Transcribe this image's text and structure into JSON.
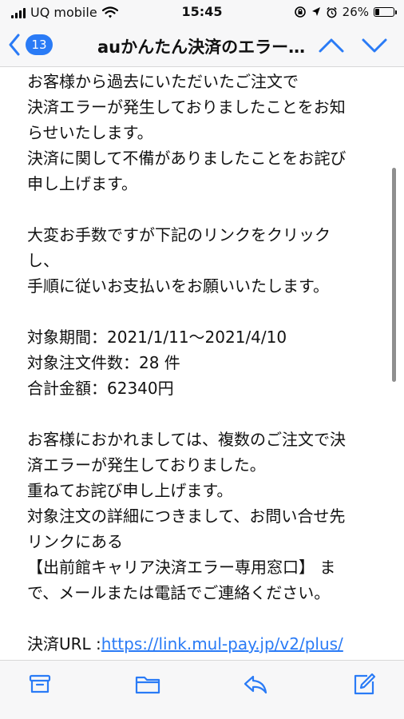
{
  "status_bar": {
    "carrier": "UQ mobile",
    "time": "15:45",
    "battery_percent": "26%",
    "battery_level": 0.26
  },
  "nav": {
    "back_count": "13",
    "title": "auかんたん決済のエラー…"
  },
  "email": {
    "lines": [
      "お客様から過去にいただいたご注文で",
      "決済エラーが発生しておりましたことをお知",
      "らせいたします。",
      "決済に関して不備がありましたことをお詫び",
      "申し上げます。",
      "",
      "大変お手数ですが下記のリンクをクリック",
      "し、",
      "手順に従いお支払いをお願いいたします。",
      "",
      "対象期間：2021/1/11～2021/4/10",
      "対象注文件数：28 件",
      "合計金額：62340円",
      "",
      "お客様におかれましては、複数のご注文で決",
      "済エラーが発生しておりました。",
      "重ねてお詫び申し上げます。",
      "対象注文の詳細につきまして、お問い合せ先",
      "リンクにある",
      "【出前館キャリア決済エラー専用窓口】 ま",
      "で、メールまたは電話でご連絡ください。",
      ""
    ],
    "url_label": "決済URL :",
    "url_link": "https://link.mul-pay.jp/v2/plus/"
  },
  "toolbar": {
    "icons": [
      "archive-icon",
      "folder-icon",
      "reply-icon",
      "compose-icon"
    ]
  },
  "colors": {
    "accent": "#2a7bf6",
    "bar_bg": "#f7f7f8"
  }
}
